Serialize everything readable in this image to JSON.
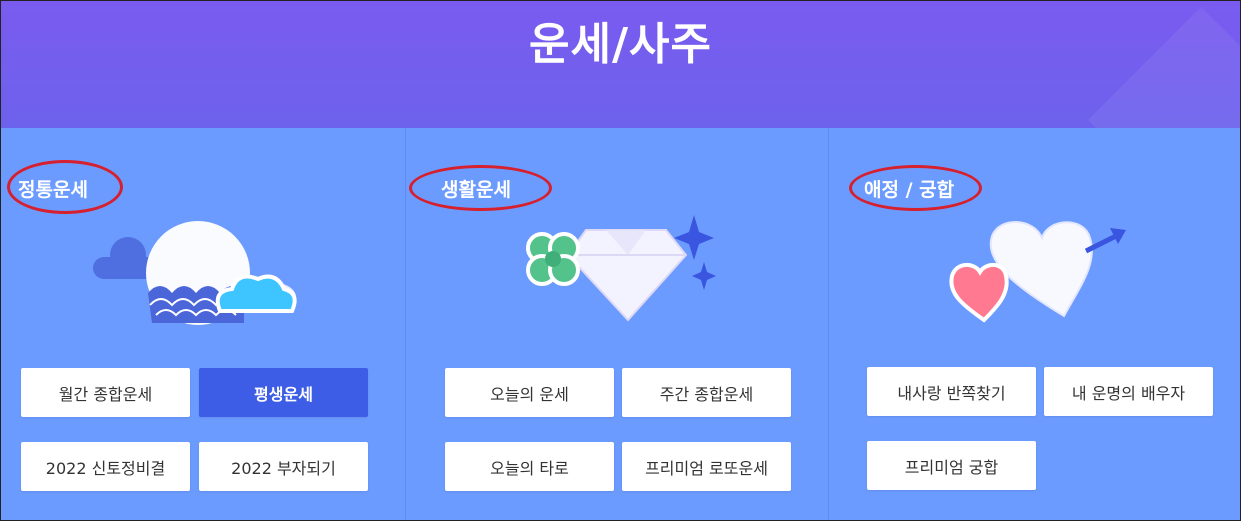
{
  "header": {
    "title": "운세/사주"
  },
  "sections": [
    {
      "title": "정통운세",
      "buttons": [
        {
          "label": "월간 종합운세",
          "active": false
        },
        {
          "label": "평생운세",
          "active": true
        },
        {
          "label": "2022 신토정비결",
          "active": false
        },
        {
          "label": "2022 부자되기",
          "active": false
        }
      ]
    },
    {
      "title": "생활운세",
      "buttons": [
        {
          "label": "오늘의 운세",
          "active": false
        },
        {
          "label": "주간 종합운세",
          "active": false
        },
        {
          "label": "오늘의 타로",
          "active": false
        },
        {
          "label": "프리미엄 로또운세",
          "active": false
        }
      ]
    },
    {
      "title": "애정 / 궁합",
      "buttons": [
        {
          "label": "내사랑 반쪽찾기",
          "active": false
        },
        {
          "label": "내 운명의 배우자",
          "active": false
        },
        {
          "label": "프리미엄 궁합",
          "active": false
        }
      ]
    }
  ],
  "colors": {
    "header_bg": "#7060ee",
    "body_bg": "#6b9bff",
    "active_button": "#3e5de6",
    "annotation_circle": "#d6202e"
  },
  "icons": [
    "moon-cloud-icon",
    "clover-diamond-icon",
    "hearts-arrow-icon"
  ]
}
